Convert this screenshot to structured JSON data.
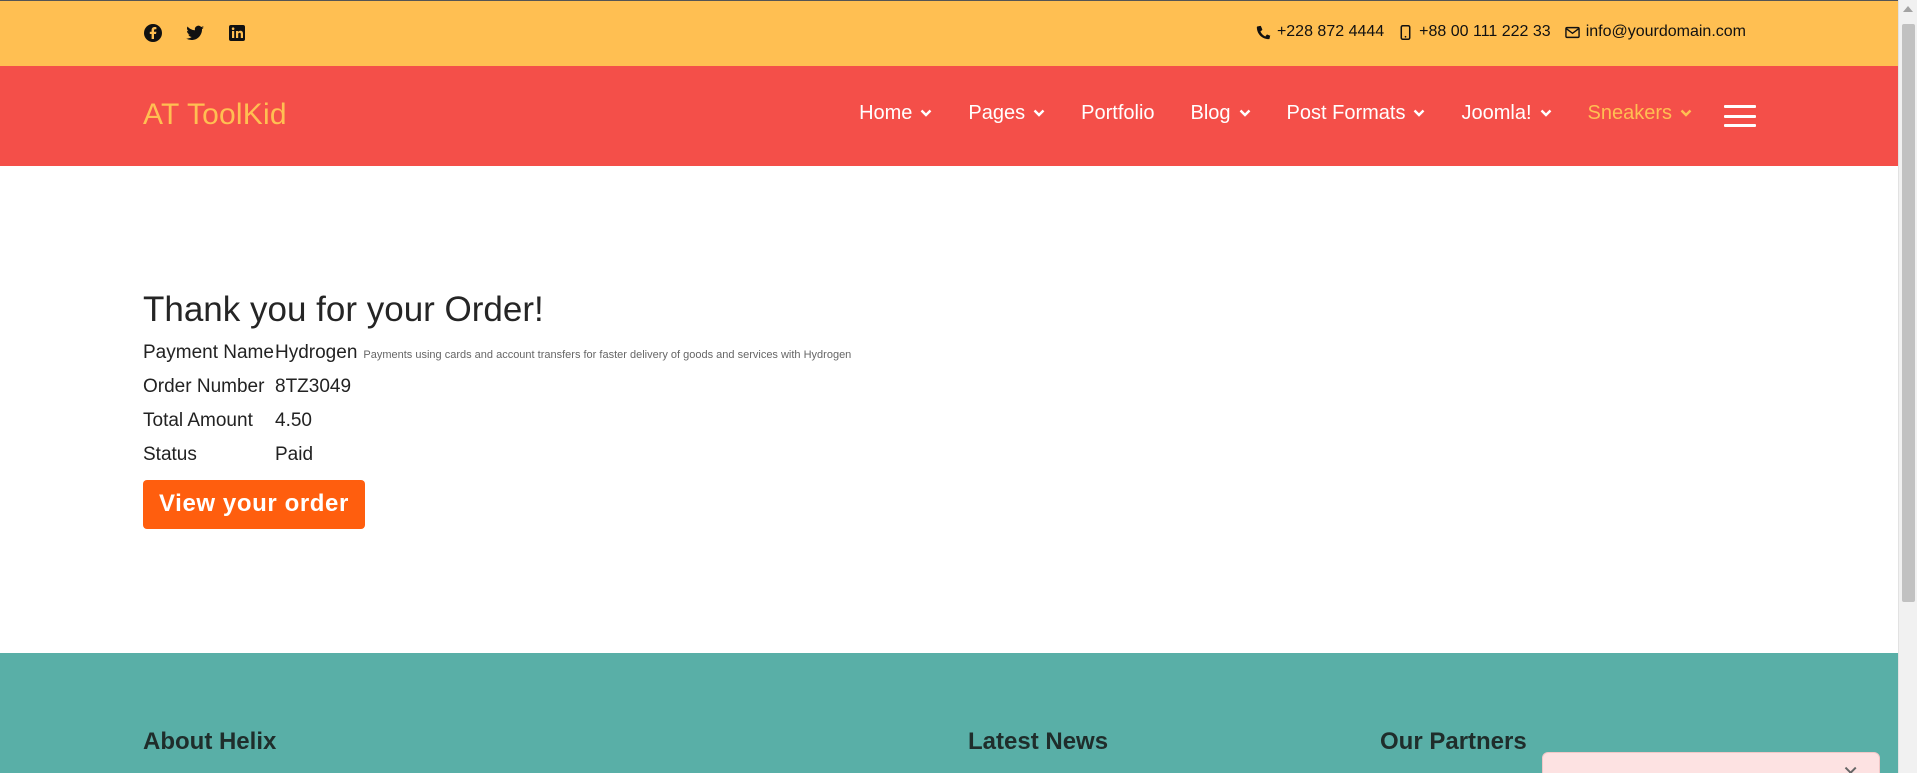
{
  "topbar": {
    "social": [
      "facebook-icon",
      "twitter-icon",
      "linkedin-icon"
    ],
    "phone": "+228 872 4444",
    "mobile": "+88 00 111 222 33",
    "email": "info@yourdomain.com"
  },
  "header": {
    "logo": "AT ToolKid",
    "menu": [
      {
        "label": "Home",
        "dropdown": true
      },
      {
        "label": "Pages",
        "dropdown": true
      },
      {
        "label": "Portfolio",
        "dropdown": false
      },
      {
        "label": "Blog",
        "dropdown": true
      },
      {
        "label": "Post Formats",
        "dropdown": true
      },
      {
        "label": "Joomla!",
        "dropdown": true
      },
      {
        "label": "Sneakers",
        "dropdown": true,
        "active": true
      }
    ]
  },
  "order": {
    "title": "Thank you for your Order!",
    "payment_label": "Payment Name",
    "payment_value": "Hydrogen",
    "payment_desc": "Payments using cards and account transfers for faster delivery of goods and services with Hydrogen",
    "order_label": "Order Number",
    "order_value": "8TZ3049",
    "total_label": "Total Amount",
    "total_value": "4.50",
    "status_label": "Status",
    "status_value": "Paid",
    "button": "View your order"
  },
  "footer": {
    "col1": "About Helix",
    "col2": "Latest News",
    "col3": "Our Partners"
  },
  "colors": {
    "topbar": "#ffbf52",
    "navbar": "#f44f49",
    "accent": "#ffbf52",
    "button": "#ff5e0e",
    "footer": "#59afa7"
  }
}
